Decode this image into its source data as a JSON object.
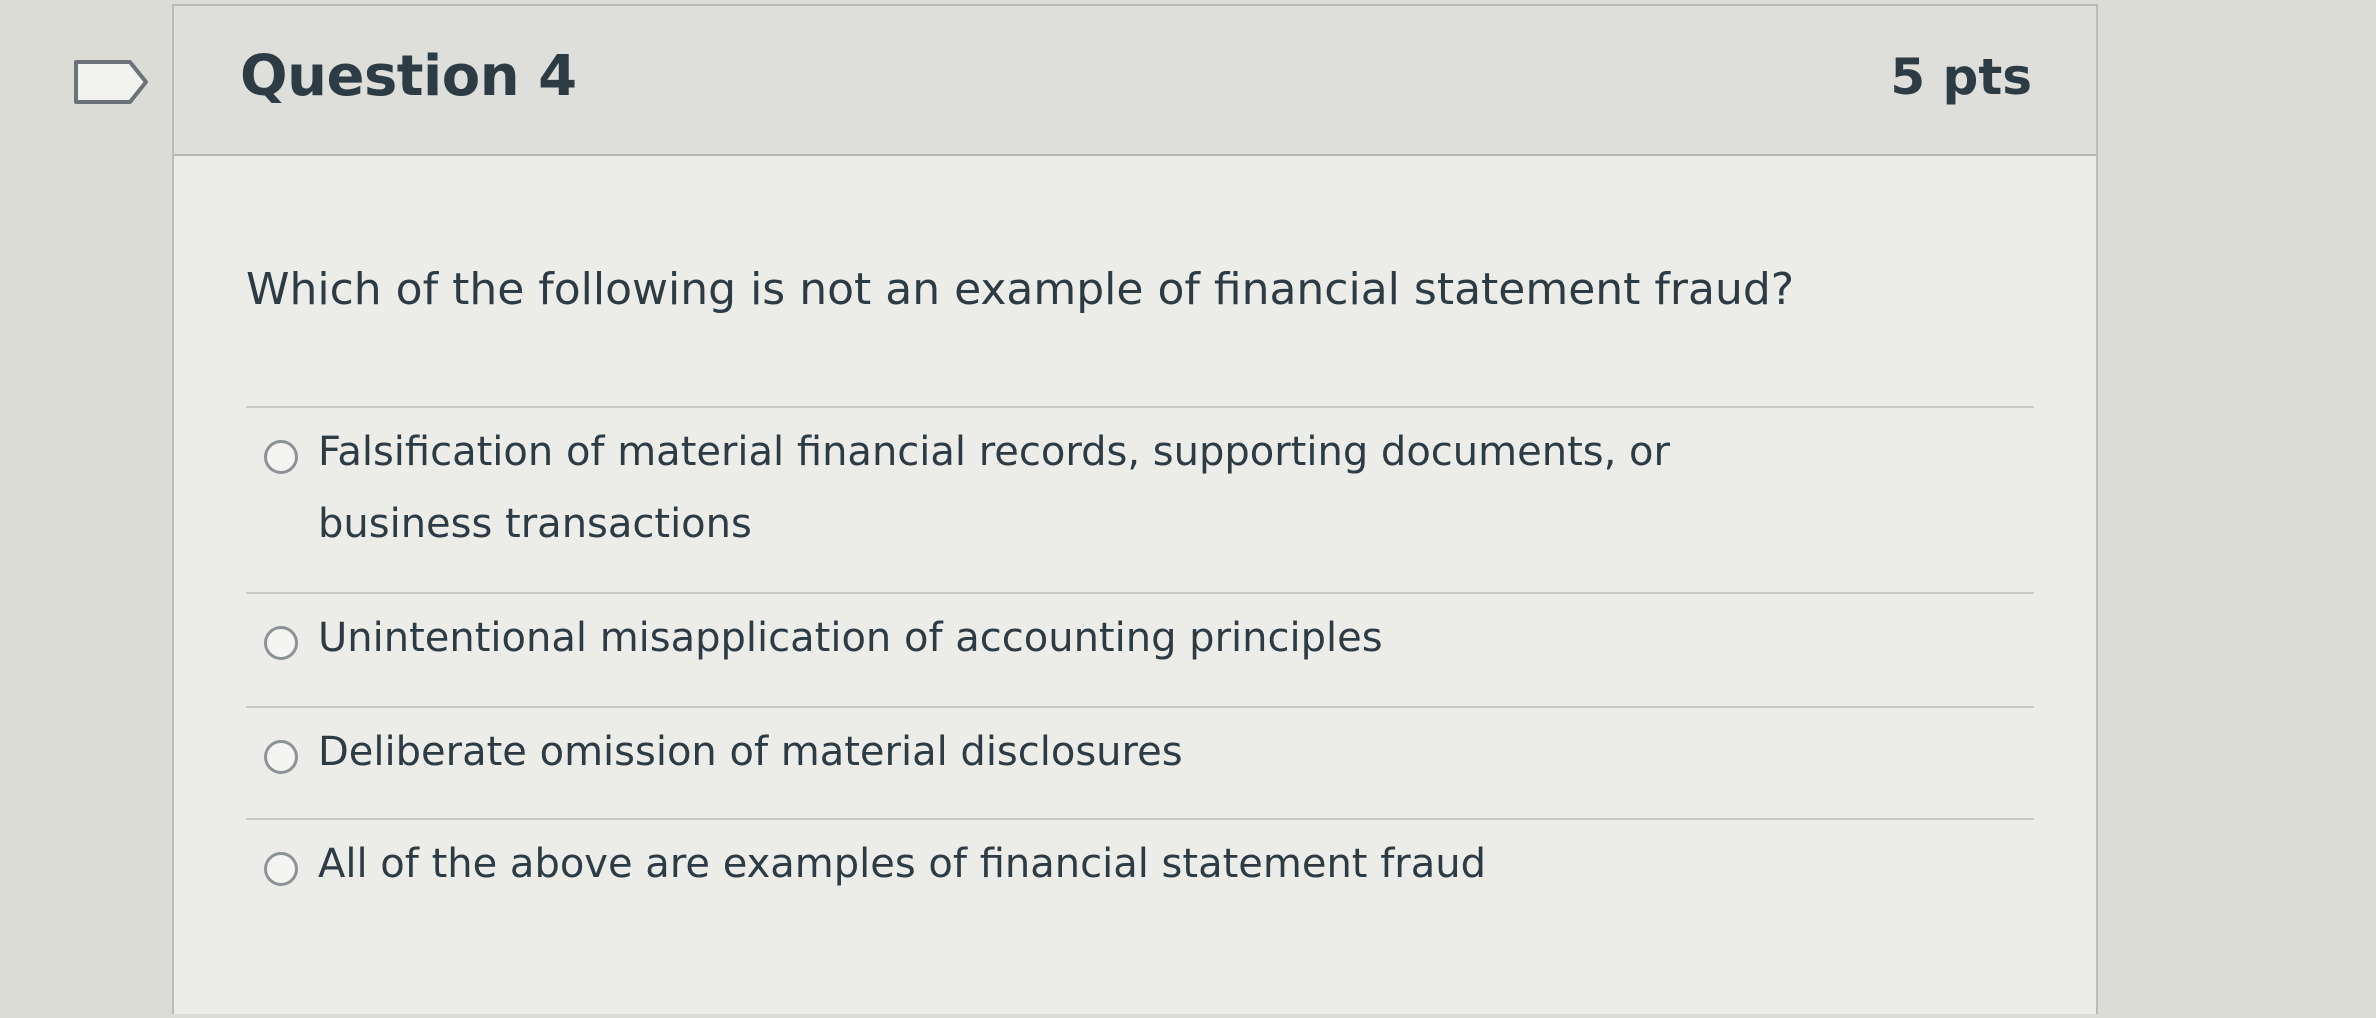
{
  "question": {
    "title": "Question 4",
    "points": "5 pts",
    "prompt": "Which of the following is not an example of financial statement fraud?",
    "options": [
      {
        "label": "Falsification of material financial records, supporting documents, or business transactions",
        "selected": false
      },
      {
        "label": "Unintentional misapplication of accounting principles",
        "selected": false
      },
      {
        "label": "Deliberate omission of material disclosures",
        "selected": false
      },
      {
        "label": "All of the above are examples of financial statement fraud",
        "selected": false
      }
    ]
  },
  "icons": {
    "flag": "bookmark-flag-icon",
    "radio": "radio-button-icon"
  },
  "colors": {
    "text": "#2d3b45",
    "header_bg": "#dedfdb",
    "card_bg": "#ecece8",
    "border": "#b9bcbc"
  }
}
